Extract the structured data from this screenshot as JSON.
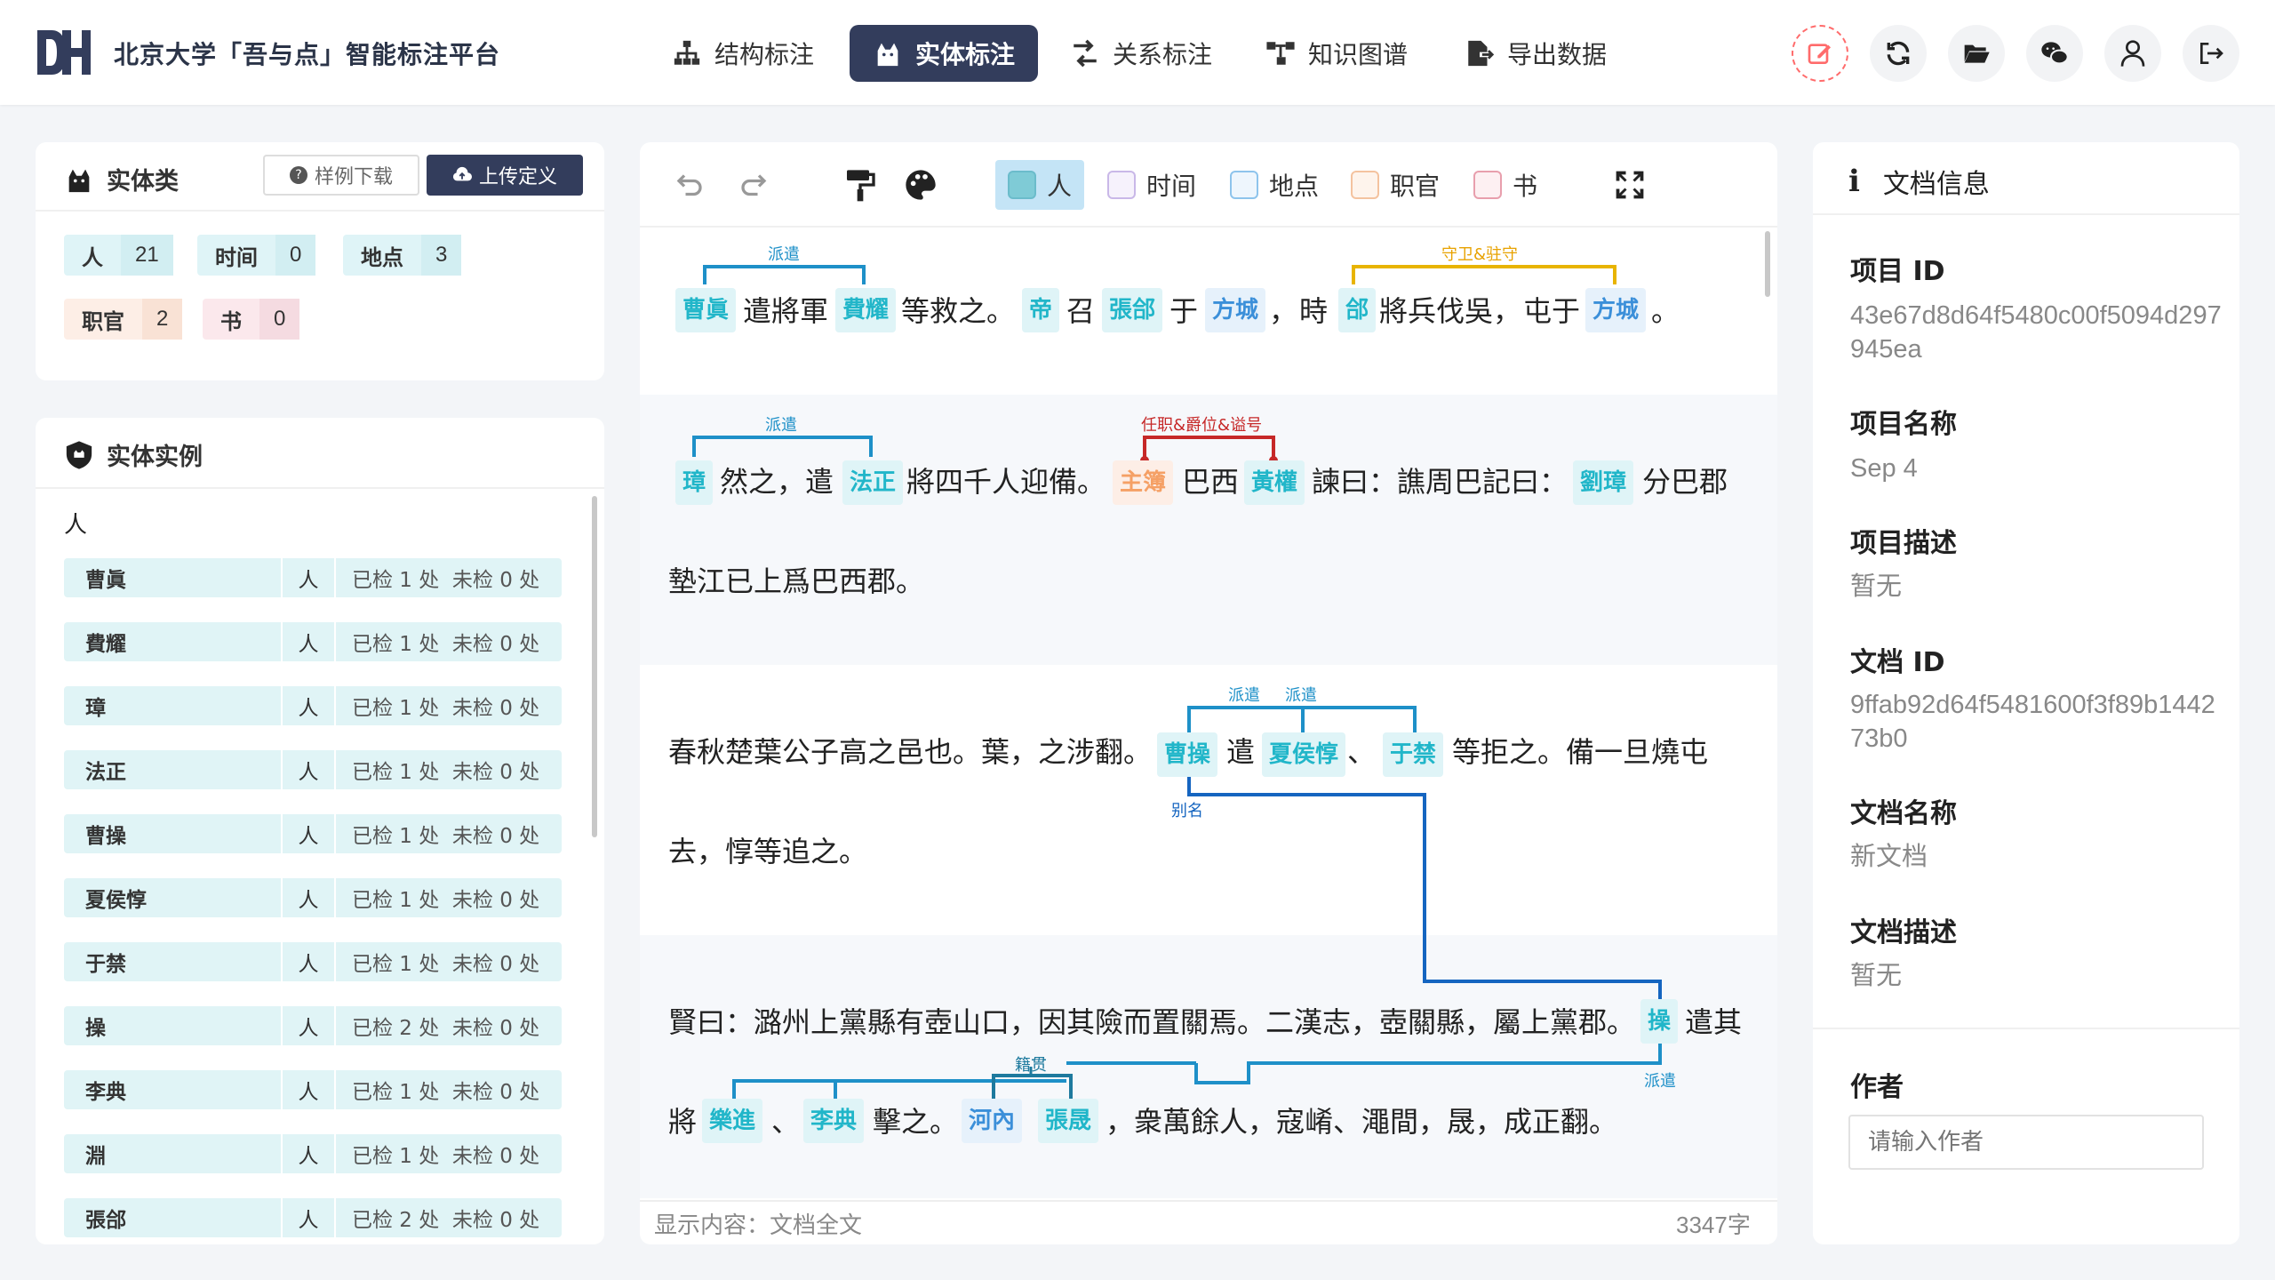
{
  "header": {
    "app_title": "北京大学「吾与点」智能标注平台",
    "nav": [
      {
        "label": "结构标注",
        "icon": "sitemap-icon"
      },
      {
        "label": "实体标注",
        "icon": "cat-icon",
        "active": true
      },
      {
        "label": "关系标注",
        "icon": "arrows-icon"
      },
      {
        "label": "知识图谱",
        "icon": "project-diagram-icon"
      },
      {
        "label": "导出数据",
        "icon": "file-export-icon"
      }
    ],
    "actions": [
      "edit-icon",
      "refresh-icon",
      "folder-open-icon",
      "wechat-icon",
      "user-icon",
      "logout-icon"
    ]
  },
  "entity_types": {
    "title": "实体类",
    "sample_download": "样例下载",
    "upload_definition": "上传定义",
    "tags": [
      {
        "name": "人",
        "count": "21"
      },
      {
        "name": "时间",
        "count": "0"
      },
      {
        "name": "地点",
        "count": "3"
      },
      {
        "name": "职官",
        "count": "2"
      },
      {
        "name": "书",
        "count": "0"
      }
    ]
  },
  "entity_instances": {
    "title": "实体实例",
    "group": "人",
    "rows": [
      {
        "name": "曹眞",
        "type": "人",
        "status": "已检 1 处  未检 0 处"
      },
      {
        "name": "費耀",
        "type": "人",
        "status": "已检 1 处  未检 0 处"
      },
      {
        "name": "璋",
        "type": "人",
        "status": "已检 1 处  未检 0 处"
      },
      {
        "name": "法正",
        "type": "人",
        "status": "已检 1 处  未检 0 处"
      },
      {
        "name": "曹操",
        "type": "人",
        "status": "已检 1 处  未检 0 处"
      },
      {
        "name": "夏侯惇",
        "type": "人",
        "status": "已检 1 处  未检 0 处"
      },
      {
        "name": "于禁",
        "type": "人",
        "status": "已检 1 处  未检 0 处"
      },
      {
        "name": "操",
        "type": "人",
        "status": "已检 2 处  未检 0 处"
      },
      {
        "name": "李典",
        "type": "人",
        "status": "已检 1 处  未检 0 处"
      },
      {
        "name": "淵",
        "type": "人",
        "status": "已检 1 处  未检 0 处"
      },
      {
        "name": "張郃",
        "type": "人",
        "status": "已检 2 处  未检 0 处"
      }
    ]
  },
  "editor": {
    "legend": [
      {
        "label": "人",
        "color": "#8fd3dd",
        "fill": "#7fcbd6",
        "selected": true
      },
      {
        "label": "时间",
        "color": "#c9b8e8",
        "fill": "#f6f2fc"
      },
      {
        "label": "地点",
        "color": "#8ec4ec",
        "fill": "#eef6fd"
      },
      {
        "label": "职官",
        "color": "#f4c39f",
        "fill": "#fef4ec"
      },
      {
        "label": "书",
        "color": "#e89fad",
        "fill": "#fdf0f2"
      }
    ],
    "paragraphs": {
      "p1": {
        "e1": "曹眞",
        "t1": "遣將軍",
        "e2": "費耀",
        "t2": "等救之。",
        "e3": "帝",
        "t3": "召",
        "e4": "張郃",
        "t4": "于",
        "e5": "方城",
        "t5": "，",
        "t6": "時",
        "e6": "郃",
        "t7": "將兵伐吳，",
        "t8": "屯于",
        "e7": "方城",
        "t9": "。",
        "r1": "派遣",
        "r2": "守卫&驻守"
      },
      "p2": {
        "e1": "璋",
        "t1": "然之，",
        "t2": "遣",
        "e2": "法正",
        "t3": "將四千人迎備。",
        "e3": "主簿",
        "t4": "巴西",
        "e4": "黃權",
        "t5": "諫曰：譙周巴記曰：",
        "e5": "劉璋",
        "t6": "分巴郡",
        "t7": "墊江已上爲巴西郡。",
        "r1": "派遣",
        "r2": "任职&爵位&谥号"
      },
      "p3": {
        "t1": "春秋楚葉公子高之邑也。葉，之涉翻。",
        "e1": "曹操",
        "t2": "遣",
        "e2": "夏侯惇",
        "t3": "、",
        "e3": "于禁",
        "t4": "等拒之。備一旦燒屯",
        "t5": "去，惇等追之。",
        "r1": "派遣",
        "r2": "派遣",
        "r3": "别名"
      },
      "p4": {
        "t1": "賢曰：潞州上黨縣有壺山口，因其險而置關焉。二漢志，壺關縣，屬上黨郡。",
        "e1": "操",
        "t2": "遣其",
        "t3": "將",
        "e2": "樂進",
        "t4": "、",
        "e3": "李典",
        "t5": "擊之。",
        "e4": "河內",
        "e5": "張晟",
        "t6": "，衆萬餘人，寇崤、澠間，晟，成正翻。",
        "r1": "籍贯",
        "r2": "派遣"
      }
    },
    "status_left": "显示内容：文档全文",
    "status_right": "3347字"
  },
  "doc_info": {
    "title": "文档信息",
    "project_id_label": "项目 ID",
    "project_id": "43e67d8d64f5480c00f5094d297945ea",
    "project_name_label": "项目名称",
    "project_name": "Sep 4",
    "project_desc_label": "项目描述",
    "project_desc": "暂无",
    "doc_id_label": "文档 ID",
    "doc_id": "9ffab92d64f5481600f3f89b144273b0",
    "doc_name_label": "文档名称",
    "doc_name": "新文档",
    "doc_desc_label": "文档描述",
    "doc_desc": "暂无",
    "author_label": "作者",
    "author_placeholder": "请输入作者"
  }
}
